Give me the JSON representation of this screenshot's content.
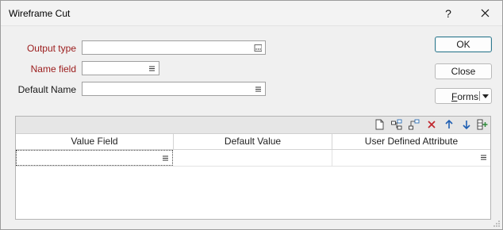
{
  "window": {
    "title": "Wireframe Cut",
    "help": "?"
  },
  "form": {
    "output_type": {
      "label": "Output type",
      "value": ""
    },
    "name_field": {
      "label": "Name field",
      "value": ""
    },
    "default_name": {
      "label": "Default Name",
      "value": ""
    }
  },
  "buttons": {
    "ok": "OK",
    "close": "Close",
    "forms_prefix": "F",
    "forms_rest": "orms"
  },
  "grid": {
    "columns": [
      "Value Field",
      "Default Value",
      "User Defined Attribute"
    ],
    "rows": [
      {
        "value_field": "",
        "default_value": "",
        "user_defined_attribute": ""
      }
    ]
  },
  "icons": [
    "new-icon",
    "insert-above-icon",
    "insert-below-icon",
    "delete-icon",
    "move-up-icon",
    "move-down-icon",
    "add-column-icon"
  ]
}
